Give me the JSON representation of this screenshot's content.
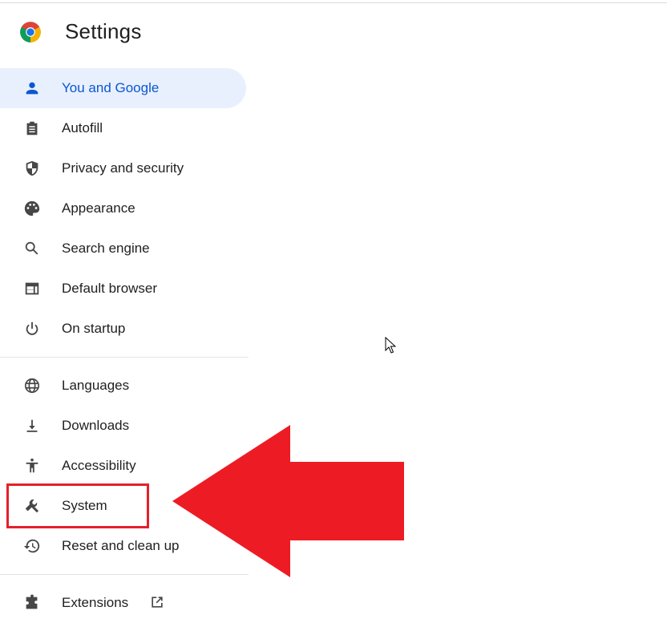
{
  "header": {
    "title": "Settings",
    "logo": "chrome-logo-icon"
  },
  "nav": {
    "items": [
      {
        "label": "You and Google",
        "icon": "person-icon",
        "selected": true
      },
      {
        "label": "Autofill",
        "icon": "clipboard-icon"
      },
      {
        "label": "Privacy and security",
        "icon": "shield-icon"
      },
      {
        "label": "Appearance",
        "icon": "palette-icon"
      },
      {
        "label": "Search engine",
        "icon": "search-icon"
      },
      {
        "label": "Default browser",
        "icon": "browser-window-icon"
      },
      {
        "label": "On startup",
        "icon": "power-icon"
      },
      {
        "label": "Languages",
        "icon": "globe-icon"
      },
      {
        "label": "Downloads",
        "icon": "download-icon"
      },
      {
        "label": "Accessibility",
        "icon": "accessibility-icon"
      },
      {
        "label": "System",
        "icon": "wrench-icon",
        "highlighted": true
      },
      {
        "label": "Reset and clean up",
        "icon": "history-reset-icon"
      },
      {
        "label": "Extensions",
        "icon": "puzzle-icon",
        "external": true
      }
    ]
  },
  "annotation": {
    "arrow_color": "#ed1c24",
    "box_color": "#e5202a",
    "target": "System"
  },
  "colors": {
    "accent": "#0b57d0",
    "selected_bg": "#e8f0fe",
    "icon": "#474747",
    "text": "#1f1f1f"
  }
}
